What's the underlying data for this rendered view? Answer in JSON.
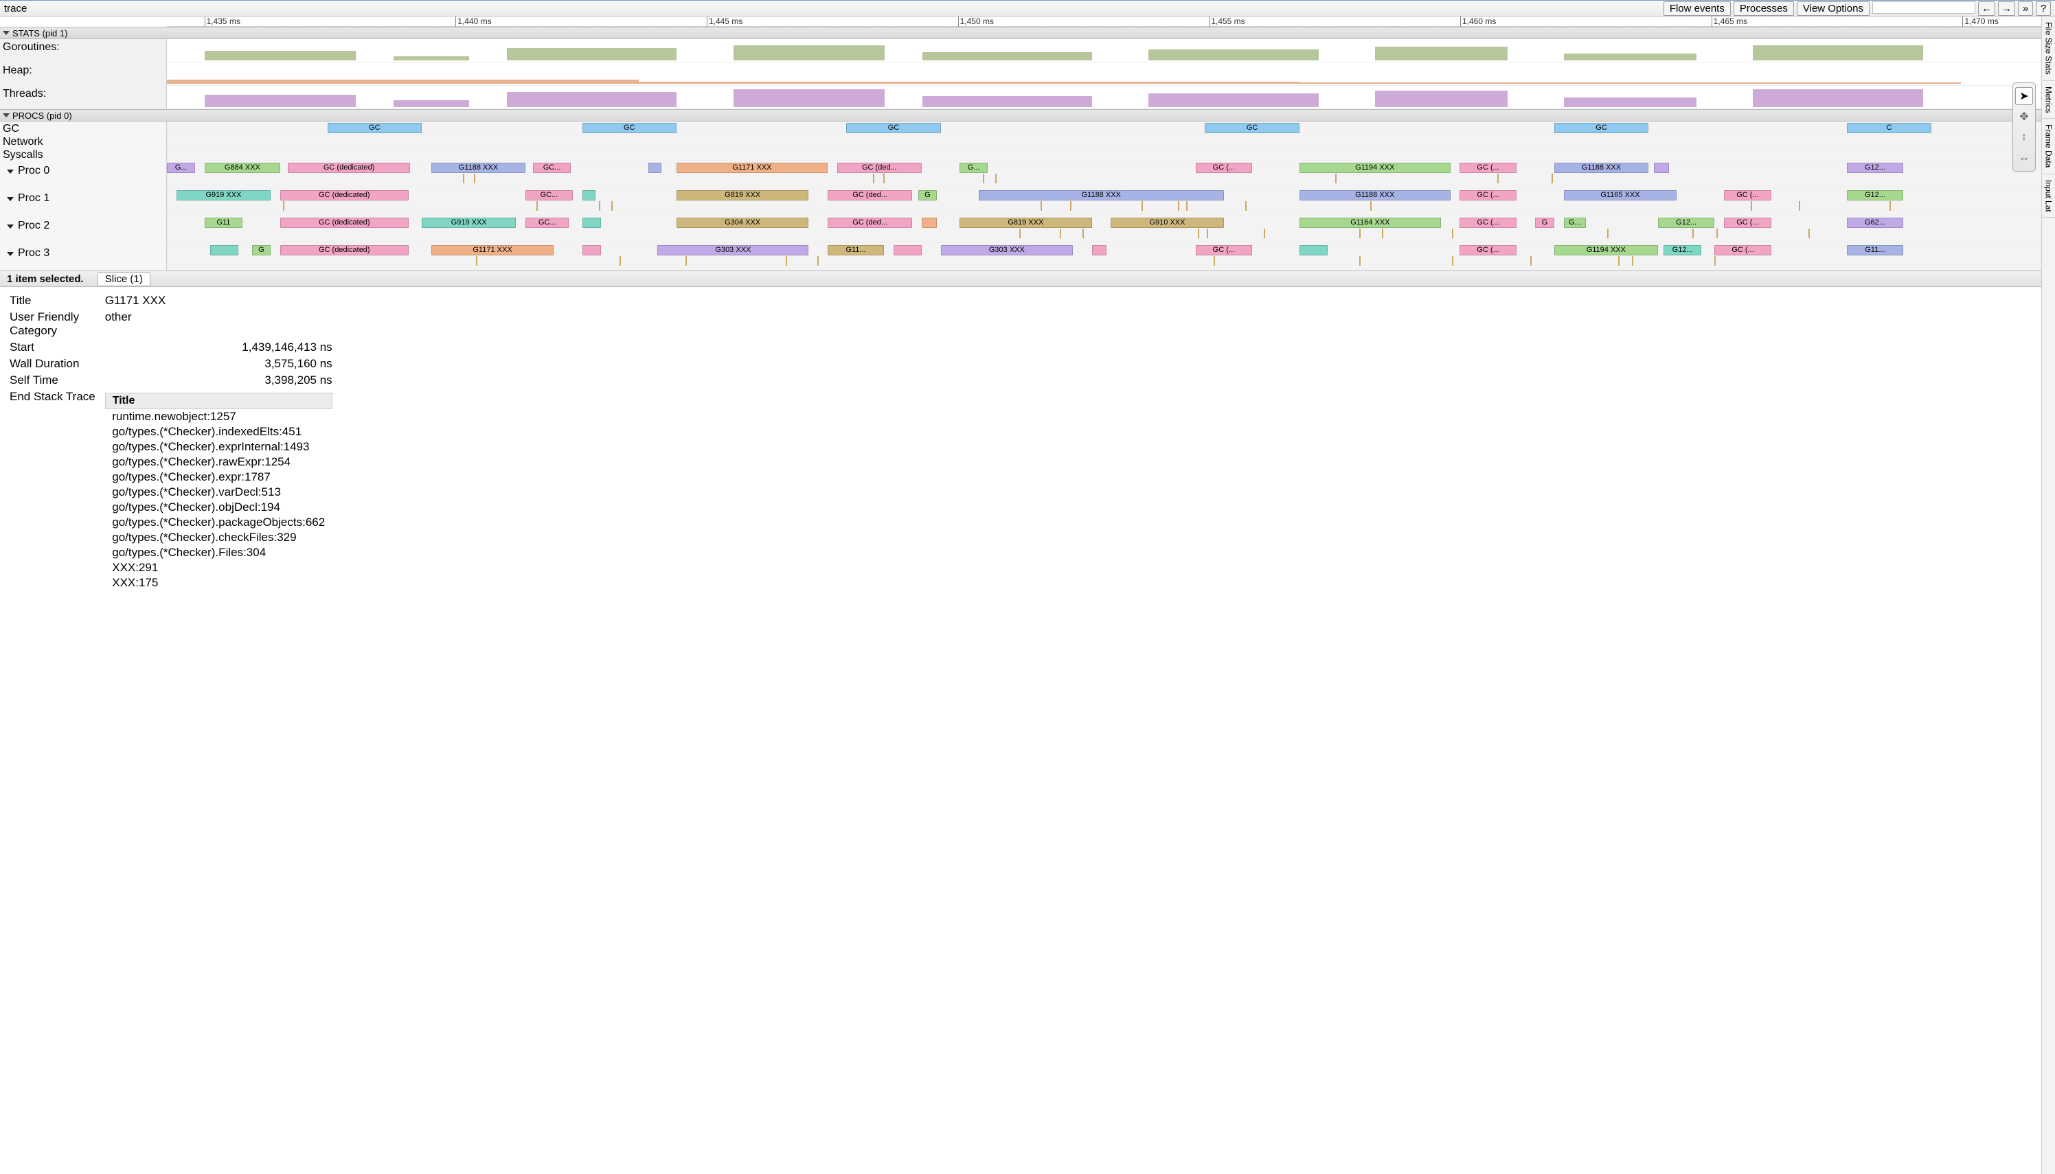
{
  "title": "trace",
  "header_buttons": {
    "flow": "Flow events",
    "procs": "Processes",
    "view": "View Options",
    "back": "←",
    "fwd": "→",
    "more": "»",
    "help": "?"
  },
  "ruler_ticks": [
    "1,435 ms",
    "1,440 ms",
    "1,445 ms",
    "1,450 ms",
    "1,455 ms",
    "1,460 ms",
    "1,465 ms",
    "1,470 ms"
  ],
  "sections": {
    "stats": "STATS (pid 1)",
    "procs": "PROCS (pid 0)"
  },
  "stats_rows": {
    "goroutines": "Goroutines:",
    "heap": "Heap:",
    "threads": "Threads:"
  },
  "top_tracks": {
    "gc": "GC",
    "network": "Network",
    "syscalls": "Syscalls"
  },
  "proc_labels": [
    "Proc 0",
    "Proc 1",
    "Proc 2",
    "Proc 3"
  ],
  "gc_slices": [
    {
      "l": 8.5,
      "w": 5,
      "t": "GC"
    },
    {
      "l": 22,
      "w": 5,
      "t": "GC"
    },
    {
      "l": 36,
      "w": 5,
      "t": "GC"
    },
    {
      "l": 55,
      "w": 5,
      "t": "GC"
    },
    {
      "l": 73.5,
      "w": 5,
      "t": "GC"
    },
    {
      "l": 89,
      "w": 4.5,
      "t": "C"
    }
  ],
  "proc_slices": [
    [
      {
        "l": 0,
        "w": 1.5,
        "c": "c-lav",
        "t": "G..."
      },
      {
        "l": 2,
        "w": 4,
        "c": "c-green",
        "t": "G884 XXX"
      },
      {
        "l": 6.4,
        "w": 6.5,
        "c": "c-pink",
        "t": "GC (dedicated)"
      },
      {
        "l": 14,
        "w": 5,
        "c": "c-perib",
        "t": "G1188 XXX"
      },
      {
        "l": 19.4,
        "w": 2,
        "c": "c-pink",
        "t": "GC..."
      },
      {
        "l": 25.5,
        "w": 0.7,
        "c": "c-perib",
        "t": ""
      },
      {
        "l": 27,
        "w": 8,
        "c": "c-orange",
        "t": "G1171 XXX"
      },
      {
        "l": 35.5,
        "w": 4.5,
        "c": "c-pink",
        "t": "GC (ded..."
      },
      {
        "l": 42,
        "w": 1.5,
        "c": "c-green",
        "t": "G..."
      },
      {
        "l": 54.5,
        "w": 3,
        "c": "c-pink",
        "t": "GC (..."
      },
      {
        "l": 60,
        "w": 8,
        "c": "c-green",
        "t": "G1194 XXX"
      },
      {
        "l": 68.5,
        "w": 3,
        "c": "c-pink",
        "t": "GC (..."
      },
      {
        "l": 73.5,
        "w": 5,
        "c": "c-perib",
        "t": "G1188 XXX"
      },
      {
        "l": 78.8,
        "w": 0.8,
        "c": "c-lav",
        "t": ""
      },
      {
        "l": 89,
        "w": 3,
        "c": "c-lav",
        "t": "G12..."
      }
    ],
    [
      {
        "l": 0.5,
        "w": 5,
        "c": "c-teal",
        "t": "G919 XXX"
      },
      {
        "l": 6,
        "w": 6.8,
        "c": "c-pink",
        "t": "GC (dedicated)"
      },
      {
        "l": 19,
        "w": 2.5,
        "c": "c-pink",
        "t": "GC..."
      },
      {
        "l": 22,
        "w": 0.7,
        "c": "c-teal",
        "t": ""
      },
      {
        "l": 27,
        "w": 7,
        "c": "c-tan",
        "t": "G819 XXX"
      },
      {
        "l": 35,
        "w": 4.5,
        "c": "c-pink",
        "t": "GC (ded..."
      },
      {
        "l": 39.8,
        "w": 1,
        "c": "c-green",
        "t": "G"
      },
      {
        "l": 43,
        "w": 13,
        "c": "c-perib",
        "t": "G1188 XXX"
      },
      {
        "l": 60,
        "w": 8,
        "c": "c-perib",
        "t": "G1188 XXX"
      },
      {
        "l": 68.5,
        "w": 3,
        "c": "c-pink",
        "t": "GC (..."
      },
      {
        "l": 74,
        "w": 6,
        "c": "c-perib",
        "t": "G1165 XXX"
      },
      {
        "l": 82.5,
        "w": 2.5,
        "c": "c-pink",
        "t": "GC (..."
      },
      {
        "l": 89,
        "w": 3,
        "c": "c-green",
        "t": "G12..."
      }
    ],
    [
      {
        "l": 2,
        "w": 2,
        "c": "c-green",
        "t": "G11"
      },
      {
        "l": 6,
        "w": 6.8,
        "c": "c-pink",
        "t": "GC (dedicated)"
      },
      {
        "l": 13.5,
        "w": 5,
        "c": "c-teal",
        "t": "G919 XXX"
      },
      {
        "l": 19,
        "w": 2.3,
        "c": "c-pink",
        "t": "GC..."
      },
      {
        "l": 22,
        "w": 1,
        "c": "c-teal",
        "t": ""
      },
      {
        "l": 27,
        "w": 7,
        "c": "c-tan",
        "t": "G304 XXX"
      },
      {
        "l": 35,
        "w": 4.5,
        "c": "c-pink",
        "t": "GC (ded..."
      },
      {
        "l": 40,
        "w": 0.8,
        "c": "c-orange",
        "t": ""
      },
      {
        "l": 42,
        "w": 7,
        "c": "c-tan",
        "t": "G819 XXX"
      },
      {
        "l": 50,
        "w": 6,
        "c": "c-tan",
        "t": "G910 XXX"
      },
      {
        "l": 60,
        "w": 7.5,
        "c": "c-green",
        "t": "G1164 XXX"
      },
      {
        "l": 68.5,
        "w": 3,
        "c": "c-pink",
        "t": "GC (..."
      },
      {
        "l": 72.5,
        "w": 1,
        "c": "c-pink",
        "t": "G"
      },
      {
        "l": 74,
        "w": 1.2,
        "c": "c-green",
        "t": "G..."
      },
      {
        "l": 79,
        "w": 3,
        "c": "c-green",
        "t": "G12..."
      },
      {
        "l": 82.5,
        "w": 2.5,
        "c": "c-pink",
        "t": "GC (..."
      },
      {
        "l": 89,
        "w": 3,
        "c": "c-lav",
        "t": "G62..."
      }
    ],
    [
      {
        "l": 2.3,
        "w": 1.5,
        "c": "c-teal",
        "t": ""
      },
      {
        "l": 4.5,
        "w": 1,
        "c": "c-green",
        "t": "G"
      },
      {
        "l": 6,
        "w": 6.8,
        "c": "c-pink",
        "t": "GC (dedicated)"
      },
      {
        "l": 14,
        "w": 6.5,
        "c": "c-orange",
        "t": "G1171 XXX"
      },
      {
        "l": 22,
        "w": 1,
        "c": "c-pink",
        "t": ""
      },
      {
        "l": 26,
        "w": 8,
        "c": "c-lav",
        "t": "G303 XXX"
      },
      {
        "l": 35,
        "w": 3,
        "c": "c-tan",
        "t": "G11..."
      },
      {
        "l": 38.5,
        "w": 1.5,
        "c": "c-pink",
        "t": ""
      },
      {
        "l": 41,
        "w": 7,
        "c": "c-lav",
        "t": "G303 XXX"
      },
      {
        "l": 49,
        "w": 0.8,
        "c": "c-pink",
        "t": ""
      },
      {
        "l": 54.5,
        "w": 3,
        "c": "c-pink",
        "t": "GC (..."
      },
      {
        "l": 60,
        "w": 1.5,
        "c": "c-teal",
        "t": ""
      },
      {
        "l": 68.5,
        "w": 3,
        "c": "c-pink",
        "t": "GC (..."
      },
      {
        "l": 73.5,
        "w": 5.5,
        "c": "c-green",
        "t": "G1194 XXX"
      },
      {
        "l": 79.3,
        "w": 2,
        "c": "c-teal",
        "t": "G12..."
      },
      {
        "l": 82,
        "w": 3,
        "c": "c-pink",
        "t": "GC (..."
      },
      {
        "l": 89,
        "w": 3,
        "c": "c-perib",
        "t": "G11..."
      }
    ]
  ],
  "right_tabs": [
    "File Size Stats",
    "Metrics",
    "Frame Data",
    "Input Lat"
  ],
  "details": {
    "selection": "1 item selected.",
    "tab": "Slice (1)",
    "rows": {
      "title_label": "Title",
      "title_val": "G1171 XXX",
      "cat_label": "User Friendly Category",
      "cat_val": "other",
      "start_label": "Start",
      "start_val": "1,439,146,413 ns",
      "wall_label": "Wall Duration",
      "wall_val": "3,575,160 ns",
      "self_label": "Self Time",
      "self_val": "3,398,205 ns",
      "stack_label": "End Stack Trace"
    },
    "stack_header": "Title",
    "stack": [
      "runtime.newobject:1257",
      "go/types.(*Checker).indexedElts:451",
      "go/types.(*Checker).exprInternal:1493",
      "go/types.(*Checker).rawExpr:1254",
      "go/types.(*Checker).expr:1787",
      "go/types.(*Checker).varDecl:513",
      "go/types.(*Checker).objDecl:194",
      "go/types.(*Checker).packageObjects:662",
      "go/types.(*Checker).checkFiles:329",
      "go/types.(*Checker).Files:304",
      "XXX:291",
      "XXX:175"
    ]
  }
}
